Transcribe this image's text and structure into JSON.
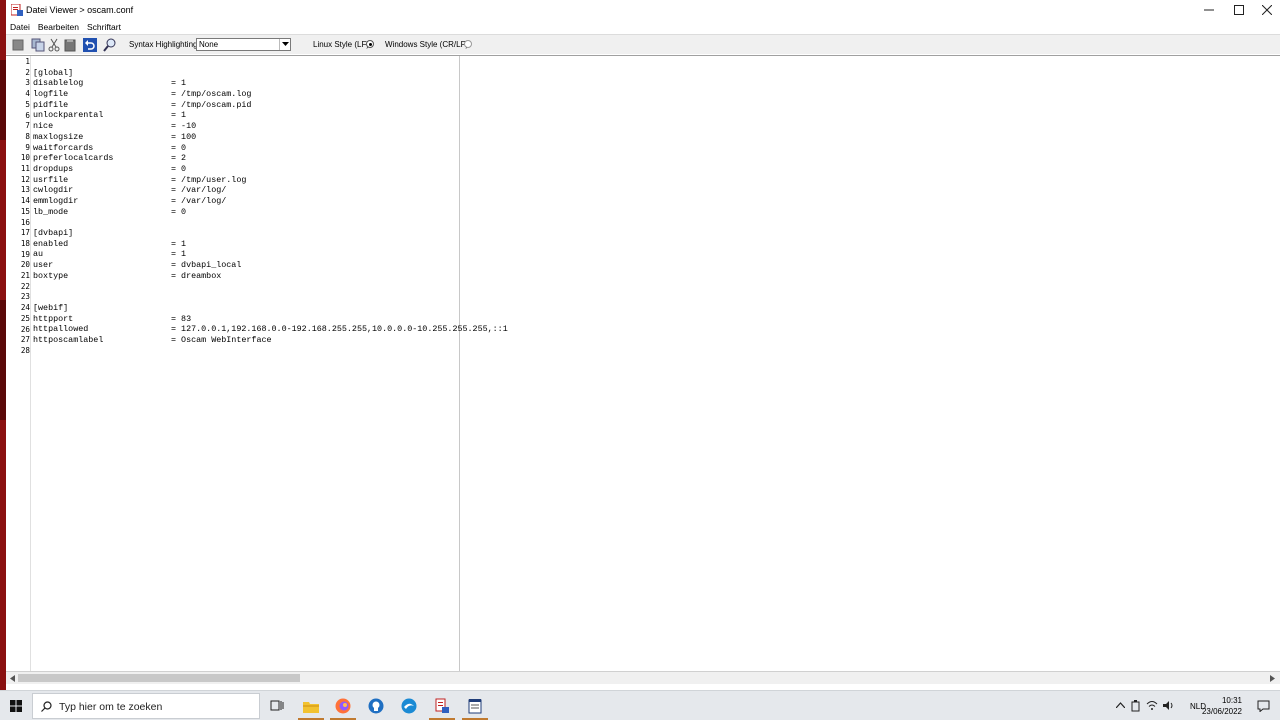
{
  "window": {
    "title": "Datei Viewer > oscam.conf",
    "controls": {
      "minimize": "—",
      "maximize": "☐",
      "close": "✕"
    }
  },
  "menu": [
    {
      "label": "Datei"
    },
    {
      "label": "Bearbeiten"
    },
    {
      "label": "Schriftart"
    }
  ],
  "toolbar": {
    "syntax_label": "Syntax Highlighting:",
    "syntax_value": "None",
    "linux_label": "Linux Style (LF)",
    "linux_selected": true,
    "windows_label": "Windows Style (CR/LF)",
    "windows_selected": false
  },
  "editor": {
    "lines": [
      {
        "n": "1",
        "key": "",
        "val": ""
      },
      {
        "n": "2",
        "key": "[global]",
        "val": ""
      },
      {
        "n": "3",
        "key": "disablelog",
        "val": "= 1"
      },
      {
        "n": "4",
        "key": "logfile",
        "val": "= /tmp/oscam.log"
      },
      {
        "n": "5",
        "key": "pidfile",
        "val": "= /tmp/oscam.pid"
      },
      {
        "n": "6",
        "key": "unlockparental",
        "val": "= 1"
      },
      {
        "n": "7",
        "key": "nice",
        "val": "= -10"
      },
      {
        "n": "8",
        "key": "maxlogsize",
        "val": "= 100"
      },
      {
        "n": "9",
        "key": "waitforcards",
        "val": "= 0"
      },
      {
        "n": "10",
        "key": "preferlocalcards",
        "val": "= 2"
      },
      {
        "n": "11",
        "key": "dropdups",
        "val": "= 0"
      },
      {
        "n": "12",
        "key": "usrfile",
        "val": "= /tmp/user.log"
      },
      {
        "n": "13",
        "key": "cwlogdir",
        "val": "= /var/log/"
      },
      {
        "n": "14",
        "key": "emmlogdir",
        "val": "= /var/log/"
      },
      {
        "n": "15",
        "key": "lb_mode",
        "val": "= 0"
      },
      {
        "n": "16",
        "key": "",
        "val": ""
      },
      {
        "n": "17",
        "key": "[dvbapi]",
        "val": ""
      },
      {
        "n": "18",
        "key": "enabled",
        "val": "= 1"
      },
      {
        "n": "19",
        "key": "au",
        "val": "= 1"
      },
      {
        "n": "20",
        "key": "user",
        "val": "= dvbapi_local"
      },
      {
        "n": "21",
        "key": "boxtype",
        "val": "= dreambox"
      },
      {
        "n": "22",
        "key": "",
        "val": ""
      },
      {
        "n": "23",
        "key": "",
        "val": ""
      },
      {
        "n": "24",
        "key": "[webif]",
        "val": ""
      },
      {
        "n": "25",
        "key": "httpport",
        "val": "= 83"
      },
      {
        "n": "26",
        "key": "httpallowed",
        "val": "= 127.0.0.1,192.168.0.0-192.168.255.255,10.0.0.0-10.255.255.255,::1"
      },
      {
        "n": "27",
        "key": "httposcamlabel",
        "val": "= Oscam WebInterface"
      },
      {
        "n": "28",
        "key": "",
        "val": ""
      }
    ]
  },
  "taskbar": {
    "search_placeholder": "Typ hier om te zoeken",
    "language": "NLD",
    "time": "10:31",
    "date": "23/06/2022"
  },
  "colors": {
    "accent_strip": "#8a1010",
    "taskbar_bg": "#e5e8ec",
    "toolbar_bg": "#f0f0f0"
  }
}
